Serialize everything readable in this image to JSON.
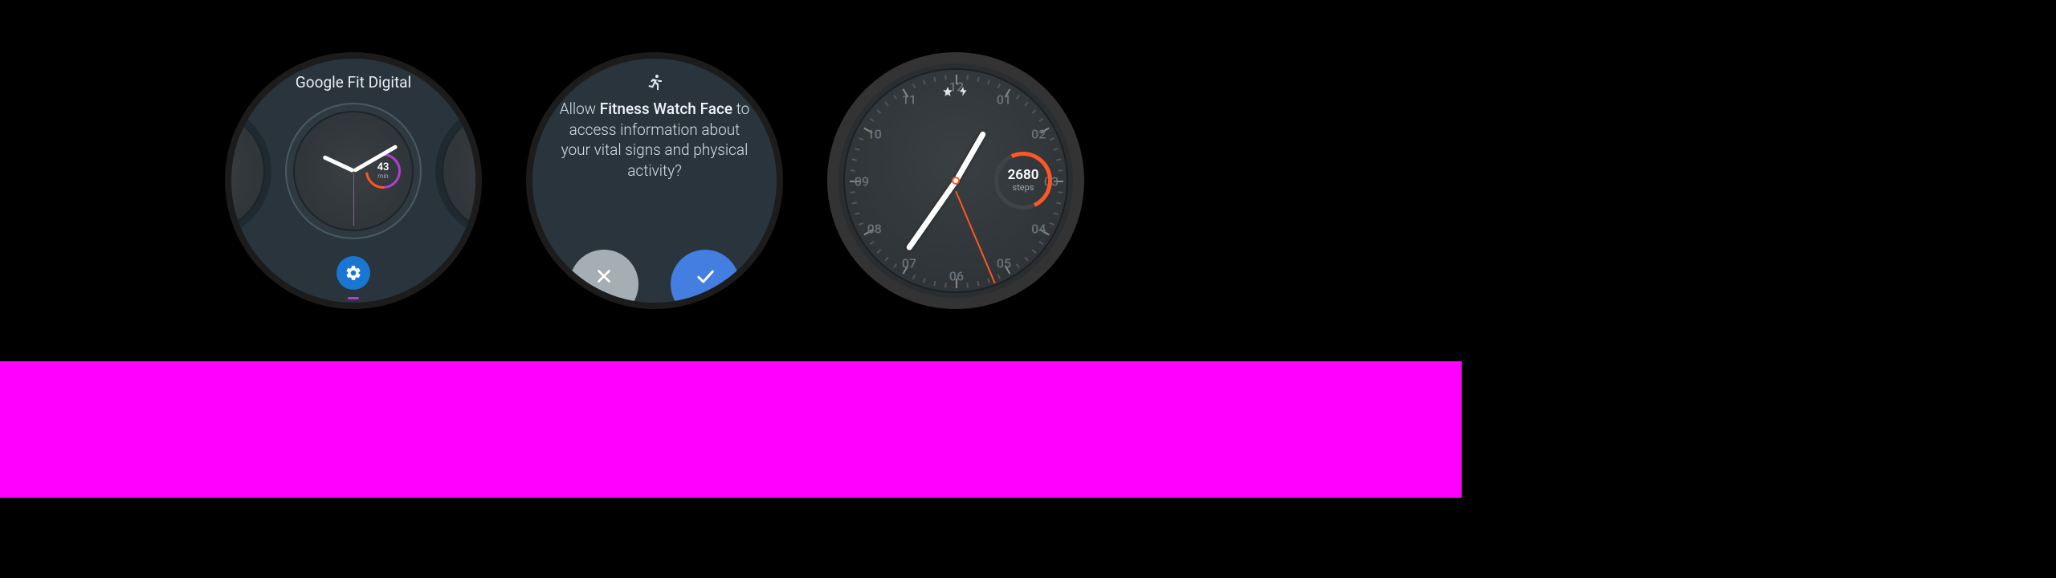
{
  "watch1": {
    "title": "Google Fit Digital",
    "subdial": {
      "value": "43",
      "label": "min"
    },
    "settings_icon": "gear-icon"
  },
  "watch2": {
    "icon": "running-icon",
    "prompt_prefix": "Allow ",
    "prompt_app": "Fitness Watch Face",
    "prompt_suffix": " to access information about your vital signs and physical activity?",
    "deny_icon": "close-icon",
    "allow_icon": "check-icon"
  },
  "watch3": {
    "status_icons": [
      "star-icon",
      "charging-icon"
    ],
    "subdial": {
      "value": "2680",
      "label": "steps"
    },
    "hours": [
      "12",
      "01",
      "02",
      "03",
      "04",
      "05",
      "06",
      "07",
      "08",
      "09",
      "10",
      "11"
    ]
  }
}
